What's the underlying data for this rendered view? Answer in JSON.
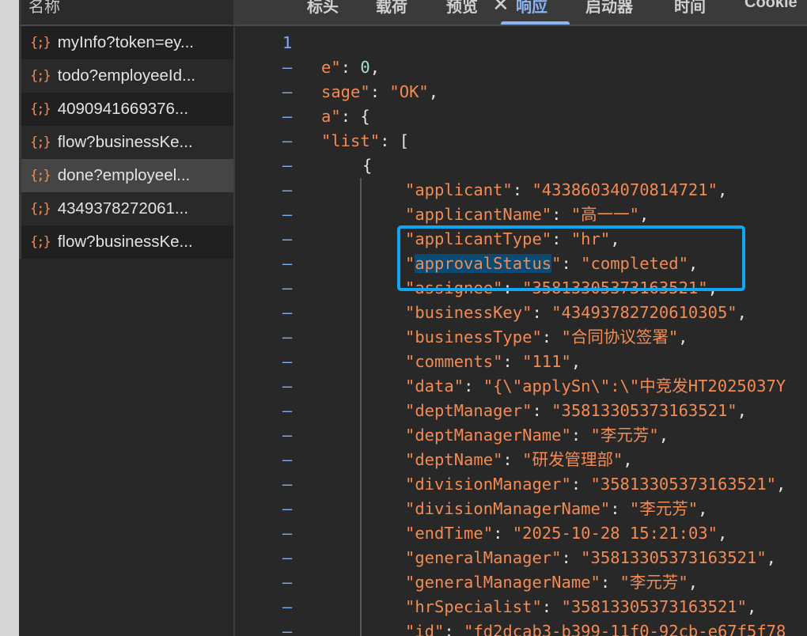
{
  "sidebar": {
    "header": "名称",
    "icon": "json-brace-icon",
    "icon_glyph": "{;}",
    "requests": [
      {
        "label": "myInfo?token=ey..."
      },
      {
        "label": "todo?employeeId..."
      },
      {
        "label": "4090941669376..."
      },
      {
        "label": "flow?businessKe..."
      },
      {
        "label": "done?employeel...",
        "selected": true
      },
      {
        "label": "4349378272061..."
      },
      {
        "label": "flow?businessKe..."
      }
    ]
  },
  "tabs": {
    "close": "✕",
    "items": [
      "标头",
      "载荷",
      "预览",
      "响应",
      "启动器",
      "时间",
      "Cookie"
    ],
    "active": "响应"
  },
  "code": {
    "lines": [
      {
        "num": "1",
        "indent": 0,
        "tokens": []
      },
      {
        "num": "–",
        "indent": 0,
        "tokens": [
          [
            "k",
            "e\""
          ],
          [
            "p",
            ": "
          ],
          [
            "n",
            "0"
          ],
          [
            "p",
            ","
          ]
        ]
      },
      {
        "num": "–",
        "indent": 0,
        "tokens": [
          [
            "k",
            "sage\""
          ],
          [
            "p",
            ": "
          ],
          [
            "s",
            "\"OK\""
          ],
          [
            "p",
            ","
          ]
        ]
      },
      {
        "num": "–",
        "indent": 0,
        "tokens": [
          [
            "k",
            "a\""
          ],
          [
            "p",
            ": {"
          ]
        ]
      },
      {
        "num": "–",
        "indent": 0,
        "tokens": [
          [
            "k",
            "\"list\""
          ],
          [
            "p",
            ": ["
          ]
        ]
      },
      {
        "num": "–",
        "indent": 1,
        "tokens": [
          [
            "p",
            "{"
          ]
        ]
      },
      {
        "num": "–",
        "indent": 2,
        "tokens": [
          [
            "k",
            "\"applicant\""
          ],
          [
            "p",
            ": "
          ],
          [
            "s",
            "\"43386034070814721\""
          ],
          [
            "p",
            ","
          ]
        ]
      },
      {
        "num": "–",
        "indent": 2,
        "tokens": [
          [
            "k",
            "\"applicantName\""
          ],
          [
            "p",
            ": "
          ],
          [
            "s",
            "\"高一一\""
          ],
          [
            "p",
            ","
          ]
        ]
      },
      {
        "num": "–",
        "indent": 2,
        "tokens": [
          [
            "k",
            "\"applicantType\""
          ],
          [
            "p",
            ": "
          ],
          [
            "s",
            "\"hr\""
          ],
          [
            "p",
            ","
          ]
        ]
      },
      {
        "num": "–",
        "indent": 2,
        "tokens": [
          [
            "k",
            "\""
          ],
          [
            "sel",
            "approvalStatus"
          ],
          [
            "k",
            "\""
          ],
          [
            "p",
            ": "
          ],
          [
            "s",
            "\"completed\""
          ],
          [
            "p",
            ","
          ]
        ]
      },
      {
        "num": "–",
        "indent": 2,
        "tokens": [
          [
            "k",
            "\"assignee\""
          ],
          [
            "p",
            ": "
          ],
          [
            "s",
            "\"35813305373163521\""
          ],
          [
            "p",
            ","
          ]
        ]
      },
      {
        "num": "–",
        "indent": 2,
        "tokens": [
          [
            "k",
            "\"businessKey\""
          ],
          [
            "p",
            ": "
          ],
          [
            "s",
            "\"43493782720610305\""
          ],
          [
            "p",
            ","
          ]
        ]
      },
      {
        "num": "–",
        "indent": 2,
        "tokens": [
          [
            "k",
            "\"businessType\""
          ],
          [
            "p",
            ": "
          ],
          [
            "s",
            "\"合同协议签署\""
          ],
          [
            "p",
            ","
          ]
        ]
      },
      {
        "num": "–",
        "indent": 2,
        "tokens": [
          [
            "k",
            "\"comments\""
          ],
          [
            "p",
            ": "
          ],
          [
            "s",
            "\"111\""
          ],
          [
            "p",
            ","
          ]
        ]
      },
      {
        "num": "–",
        "indent": 2,
        "tokens": [
          [
            "k",
            "\"data\""
          ],
          [
            "p",
            ": "
          ],
          [
            "s",
            "\"{\\\"applySn\\\":\\\"中竞发HT2025037Y"
          ]
        ]
      },
      {
        "num": "–",
        "indent": 2,
        "tokens": [
          [
            "k",
            "\"deptManager\""
          ],
          [
            "p",
            ": "
          ],
          [
            "s",
            "\"35813305373163521\""
          ],
          [
            "p",
            ","
          ]
        ]
      },
      {
        "num": "–",
        "indent": 2,
        "tokens": [
          [
            "k",
            "\"deptManagerName\""
          ],
          [
            "p",
            ": "
          ],
          [
            "s",
            "\"李元芳\""
          ],
          [
            "p",
            ","
          ]
        ]
      },
      {
        "num": "–",
        "indent": 2,
        "tokens": [
          [
            "k",
            "\"deptName\""
          ],
          [
            "p",
            ": "
          ],
          [
            "s",
            "\"研发管理部\""
          ],
          [
            "p",
            ","
          ]
        ]
      },
      {
        "num": "–",
        "indent": 2,
        "tokens": [
          [
            "k",
            "\"divisionManager\""
          ],
          [
            "p",
            ": "
          ],
          [
            "s",
            "\"35813305373163521\""
          ],
          [
            "p",
            ","
          ]
        ]
      },
      {
        "num": "–",
        "indent": 2,
        "tokens": [
          [
            "k",
            "\"divisionManagerName\""
          ],
          [
            "p",
            ": "
          ],
          [
            "s",
            "\"李元芳\""
          ],
          [
            "p",
            ","
          ]
        ]
      },
      {
        "num": "–",
        "indent": 2,
        "tokens": [
          [
            "k",
            "\"endTime\""
          ],
          [
            "p",
            ": "
          ],
          [
            "s",
            "\"2025-10-28 15:21:03\""
          ],
          [
            "p",
            ","
          ]
        ]
      },
      {
        "num": "–",
        "indent": 2,
        "tokens": [
          [
            "k",
            "\"generalManager\""
          ],
          [
            "p",
            ": "
          ],
          [
            "s",
            "\"35813305373163521\""
          ],
          [
            "p",
            ","
          ]
        ]
      },
      {
        "num": "–",
        "indent": 2,
        "tokens": [
          [
            "k",
            "\"generalManagerName\""
          ],
          [
            "p",
            ": "
          ],
          [
            "s",
            "\"李元芳\""
          ],
          [
            "p",
            ","
          ]
        ]
      },
      {
        "num": "–",
        "indent": 2,
        "tokens": [
          [
            "k",
            "\"hrSpecialist\""
          ],
          [
            "p",
            ": "
          ],
          [
            "s",
            "\"35813305373163521\""
          ],
          [
            "p",
            ","
          ]
        ]
      },
      {
        "num": "–",
        "indent": 2,
        "tokens": [
          [
            "k",
            "\"id\""
          ],
          [
            "p",
            ": "
          ],
          [
            "s",
            "\"fd2dcab3-b399-11f0-92cb-e67f5f78"
          ]
        ]
      }
    ]
  },
  "colors": {
    "accent": "#8ab4f8",
    "string": "#f28b54",
    "highlight_box": "#11a6f2"
  }
}
